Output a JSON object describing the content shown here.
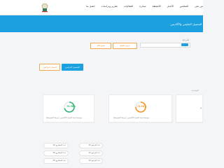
{
  "nav": {
    "items": [
      "من نحن",
      "المجلس",
      "الأخبار",
      "الأنشطة",
      "مبادرة",
      "الفعاليات",
      "تقارير ودراسات",
      "اتصل بنا"
    ]
  },
  "banner": {
    "title": "التحصيل التعليمي والأكاديمي"
  },
  "filters": {
    "label": "المرحلة",
    "select_value": "",
    "search_button": "عرض النتائج",
    "reset_button": "مسح الكل"
  },
  "chips": {
    "active": "التحصيل الدراسي",
    "inactive": "المعدل التراكمي"
  },
  "section_note": "المؤشرات",
  "cards": [
    {
      "percent": "70.38%",
      "label": "متوسط نسبة الإنجاز الأكاديمي | مرحلة المتوسطة",
      "color": "#2bb673"
    },
    {
      "percent": "73.94%",
      "label": "متوسط نسبة الإنجاز الأكاديمي | مرحلة المتوسطة",
      "color": "#f7931e"
    }
  ],
  "pills": [
    "10 عدد البرامج",
    "20 عدد المشاريع",
    "10 عدد البرامج",
    "30 عدد المشاريع",
    "10 عدد البرامج",
    "20 عدد المشاريع"
  ],
  "colors": {
    "accent": "#1ba1df",
    "orange": "#f0a64b",
    "green": "#2bb673"
  }
}
